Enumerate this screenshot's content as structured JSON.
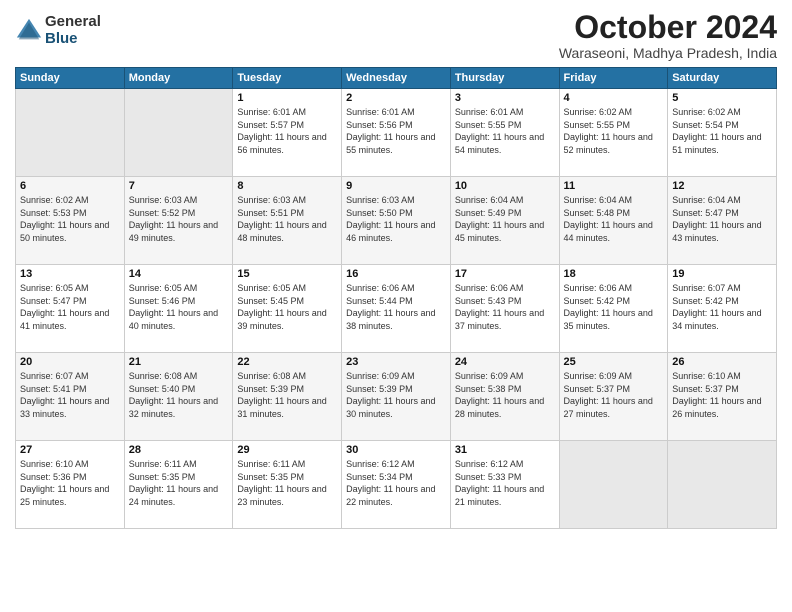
{
  "logo": {
    "general": "General",
    "blue": "Blue"
  },
  "header": {
    "month": "October 2024",
    "location": "Waraseoni, Madhya Pradesh, India"
  },
  "weekdays": [
    "Sunday",
    "Monday",
    "Tuesday",
    "Wednesday",
    "Thursday",
    "Friday",
    "Saturday"
  ],
  "weeks": [
    [
      {
        "day": "",
        "empty": true
      },
      {
        "day": "",
        "empty": true
      },
      {
        "day": "1",
        "sunrise": "6:01 AM",
        "sunset": "5:57 PM",
        "daylight": "11 hours and 56 minutes."
      },
      {
        "day": "2",
        "sunrise": "6:01 AM",
        "sunset": "5:56 PM",
        "daylight": "11 hours and 55 minutes."
      },
      {
        "day": "3",
        "sunrise": "6:01 AM",
        "sunset": "5:55 PM",
        "daylight": "11 hours and 54 minutes."
      },
      {
        "day": "4",
        "sunrise": "6:02 AM",
        "sunset": "5:55 PM",
        "daylight": "11 hours and 52 minutes."
      },
      {
        "day": "5",
        "sunrise": "6:02 AM",
        "sunset": "5:54 PM",
        "daylight": "11 hours and 51 minutes."
      }
    ],
    [
      {
        "day": "6",
        "sunrise": "6:02 AM",
        "sunset": "5:53 PM",
        "daylight": "11 hours and 50 minutes."
      },
      {
        "day": "7",
        "sunrise": "6:03 AM",
        "sunset": "5:52 PM",
        "daylight": "11 hours and 49 minutes."
      },
      {
        "day": "8",
        "sunrise": "6:03 AM",
        "sunset": "5:51 PM",
        "daylight": "11 hours and 48 minutes."
      },
      {
        "day": "9",
        "sunrise": "6:03 AM",
        "sunset": "5:50 PM",
        "daylight": "11 hours and 46 minutes."
      },
      {
        "day": "10",
        "sunrise": "6:04 AM",
        "sunset": "5:49 PM",
        "daylight": "11 hours and 45 minutes."
      },
      {
        "day": "11",
        "sunrise": "6:04 AM",
        "sunset": "5:48 PM",
        "daylight": "11 hours and 44 minutes."
      },
      {
        "day": "12",
        "sunrise": "6:04 AM",
        "sunset": "5:47 PM",
        "daylight": "11 hours and 43 minutes."
      }
    ],
    [
      {
        "day": "13",
        "sunrise": "6:05 AM",
        "sunset": "5:47 PM",
        "daylight": "11 hours and 41 minutes."
      },
      {
        "day": "14",
        "sunrise": "6:05 AM",
        "sunset": "5:46 PM",
        "daylight": "11 hours and 40 minutes."
      },
      {
        "day": "15",
        "sunrise": "6:05 AM",
        "sunset": "5:45 PM",
        "daylight": "11 hours and 39 minutes."
      },
      {
        "day": "16",
        "sunrise": "6:06 AM",
        "sunset": "5:44 PM",
        "daylight": "11 hours and 38 minutes."
      },
      {
        "day": "17",
        "sunrise": "6:06 AM",
        "sunset": "5:43 PM",
        "daylight": "11 hours and 37 minutes."
      },
      {
        "day": "18",
        "sunrise": "6:06 AM",
        "sunset": "5:42 PM",
        "daylight": "11 hours and 35 minutes."
      },
      {
        "day": "19",
        "sunrise": "6:07 AM",
        "sunset": "5:42 PM",
        "daylight": "11 hours and 34 minutes."
      }
    ],
    [
      {
        "day": "20",
        "sunrise": "6:07 AM",
        "sunset": "5:41 PM",
        "daylight": "11 hours and 33 minutes."
      },
      {
        "day": "21",
        "sunrise": "6:08 AM",
        "sunset": "5:40 PM",
        "daylight": "11 hours and 32 minutes."
      },
      {
        "day": "22",
        "sunrise": "6:08 AM",
        "sunset": "5:39 PM",
        "daylight": "11 hours and 31 minutes."
      },
      {
        "day": "23",
        "sunrise": "6:09 AM",
        "sunset": "5:39 PM",
        "daylight": "11 hours and 30 minutes."
      },
      {
        "day": "24",
        "sunrise": "6:09 AM",
        "sunset": "5:38 PM",
        "daylight": "11 hours and 28 minutes."
      },
      {
        "day": "25",
        "sunrise": "6:09 AM",
        "sunset": "5:37 PM",
        "daylight": "11 hours and 27 minutes."
      },
      {
        "day": "26",
        "sunrise": "6:10 AM",
        "sunset": "5:37 PM",
        "daylight": "11 hours and 26 minutes."
      }
    ],
    [
      {
        "day": "27",
        "sunrise": "6:10 AM",
        "sunset": "5:36 PM",
        "daylight": "11 hours and 25 minutes."
      },
      {
        "day": "28",
        "sunrise": "6:11 AM",
        "sunset": "5:35 PM",
        "daylight": "11 hours and 24 minutes."
      },
      {
        "day": "29",
        "sunrise": "6:11 AM",
        "sunset": "5:35 PM",
        "daylight": "11 hours and 23 minutes."
      },
      {
        "day": "30",
        "sunrise": "6:12 AM",
        "sunset": "5:34 PM",
        "daylight": "11 hours and 22 minutes."
      },
      {
        "day": "31",
        "sunrise": "6:12 AM",
        "sunset": "5:33 PM",
        "daylight": "11 hours and 21 minutes."
      },
      {
        "day": "",
        "empty": true
      },
      {
        "day": "",
        "empty": true
      }
    ]
  ]
}
